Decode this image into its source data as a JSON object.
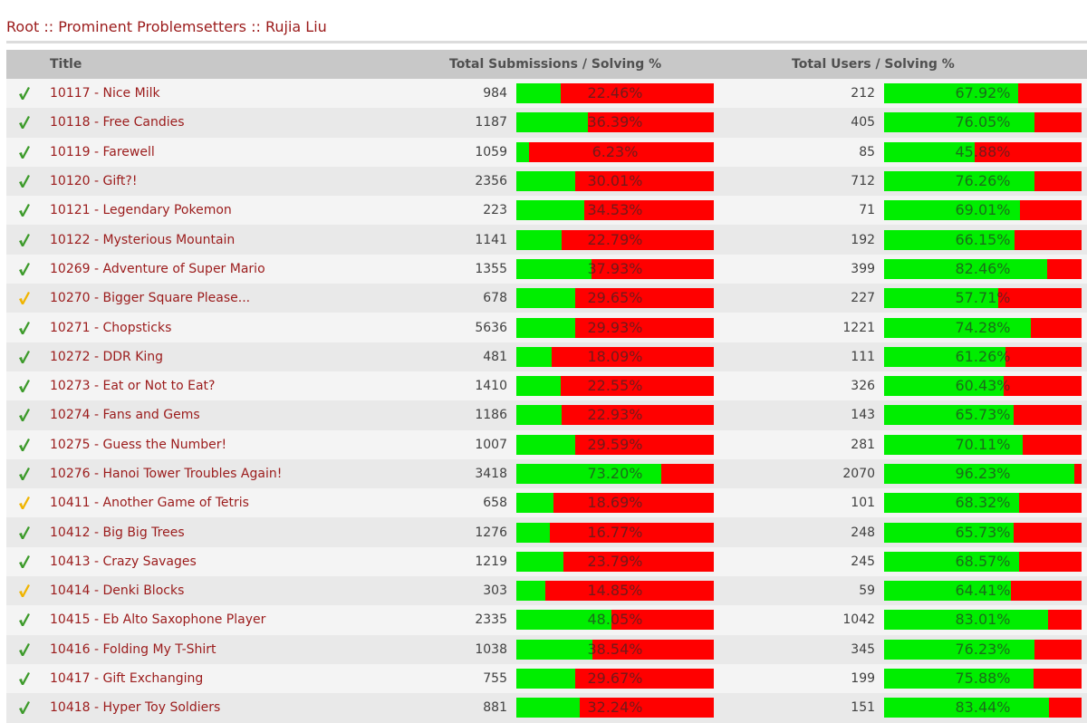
{
  "breadcrumb": [
    "Root",
    "Prominent Problemsetters",
    "Rujia Liu"
  ],
  "breadcrumb_separator": " :: ",
  "colors": {
    "solved": "#3c9a2a",
    "attempted": "#f0b400",
    "bar_solved": "#00ee00",
    "bar_unsolved": "#ff0000",
    "link": "#9b1b1b"
  },
  "table": {
    "headers": {
      "title": "Title",
      "submissions": "Total Submissions / Solving %",
      "users": "Total Users / Solving %"
    },
    "rows": [
      {
        "status": "solved",
        "title": "10117 - Nice Milk",
        "submissions": "984",
        "sub_pct": "22.46%",
        "sub_frac": 0.2246,
        "users": "212",
        "usr_pct": "67.92%",
        "usr_frac": 0.6792
      },
      {
        "status": "solved",
        "title": "10118 - Free Candies",
        "submissions": "1187",
        "sub_pct": "36.39%",
        "sub_frac": 0.3639,
        "users": "405",
        "usr_pct": "76.05%",
        "usr_frac": 0.7605
      },
      {
        "status": "solved",
        "title": "10119 - Farewell",
        "submissions": "1059",
        "sub_pct": "6.23%",
        "sub_frac": 0.0623,
        "users": "85",
        "usr_pct": "45.88%",
        "usr_frac": 0.4588
      },
      {
        "status": "solved",
        "title": "10120 - Gift?!",
        "submissions": "2356",
        "sub_pct": "30.01%",
        "sub_frac": 0.3001,
        "users": "712",
        "usr_pct": "76.26%",
        "usr_frac": 0.7626
      },
      {
        "status": "solved",
        "title": "10121 - Legendary Pokemon",
        "submissions": "223",
        "sub_pct": "34.53%",
        "sub_frac": 0.3453,
        "users": "71",
        "usr_pct": "69.01%",
        "usr_frac": 0.6901
      },
      {
        "status": "solved",
        "title": "10122 - Mysterious Mountain",
        "submissions": "1141",
        "sub_pct": "22.79%",
        "sub_frac": 0.2279,
        "users": "192",
        "usr_pct": "66.15%",
        "usr_frac": 0.6615
      },
      {
        "status": "solved",
        "title": "10269 - Adventure of Super Mario",
        "submissions": "1355",
        "sub_pct": "37.93%",
        "sub_frac": 0.3793,
        "users": "399",
        "usr_pct": "82.46%",
        "usr_frac": 0.8246
      },
      {
        "status": "attempted",
        "title": "10270 - Bigger Square Please...",
        "submissions": "678",
        "sub_pct": "29.65%",
        "sub_frac": 0.2965,
        "users": "227",
        "usr_pct": "57.71%",
        "usr_frac": 0.5771
      },
      {
        "status": "solved",
        "title": "10271 - Chopsticks",
        "submissions": "5636",
        "sub_pct": "29.93%",
        "sub_frac": 0.2993,
        "users": "1221",
        "usr_pct": "74.28%",
        "usr_frac": 0.7428
      },
      {
        "status": "solved",
        "title": "10272 - DDR King",
        "submissions": "481",
        "sub_pct": "18.09%",
        "sub_frac": 0.1809,
        "users": "111",
        "usr_pct": "61.26%",
        "usr_frac": 0.6126
      },
      {
        "status": "solved",
        "title": "10273 - Eat or Not to Eat?",
        "submissions": "1410",
        "sub_pct": "22.55%",
        "sub_frac": 0.2255,
        "users": "326",
        "usr_pct": "60.43%",
        "usr_frac": 0.6043
      },
      {
        "status": "solved",
        "title": "10274 - Fans and Gems",
        "submissions": "1186",
        "sub_pct": "22.93%",
        "sub_frac": 0.2293,
        "users": "143",
        "usr_pct": "65.73%",
        "usr_frac": 0.6573
      },
      {
        "status": "solved",
        "title": "10275 - Guess the Number!",
        "submissions": "1007",
        "sub_pct": "29.59%",
        "sub_frac": 0.2959,
        "users": "281",
        "usr_pct": "70.11%",
        "usr_frac": 0.7011
      },
      {
        "status": "solved",
        "title": "10276 - Hanoi Tower Troubles Again!",
        "submissions": "3418",
        "sub_pct": "73.20%",
        "sub_frac": 0.732,
        "users": "2070",
        "usr_pct": "96.23%",
        "usr_frac": 0.9623
      },
      {
        "status": "attempted",
        "title": "10411 - Another Game of Tetris",
        "submissions": "658",
        "sub_pct": "18.69%",
        "sub_frac": 0.1869,
        "users": "101",
        "usr_pct": "68.32%",
        "usr_frac": 0.6832
      },
      {
        "status": "solved",
        "title": "10412 - Big Big Trees",
        "submissions": "1276",
        "sub_pct": "16.77%",
        "sub_frac": 0.1677,
        "users": "248",
        "usr_pct": "65.73%",
        "usr_frac": 0.6573
      },
      {
        "status": "solved",
        "title": "10413 - Crazy Savages",
        "submissions": "1219",
        "sub_pct": "23.79%",
        "sub_frac": 0.2379,
        "users": "245",
        "usr_pct": "68.57%",
        "usr_frac": 0.6857
      },
      {
        "status": "attempted",
        "title": "10414 - Denki Blocks",
        "submissions": "303",
        "sub_pct": "14.85%",
        "sub_frac": 0.1485,
        "users": "59",
        "usr_pct": "64.41%",
        "usr_frac": 0.6441
      },
      {
        "status": "solved",
        "title": "10415 - Eb Alto Saxophone Player",
        "submissions": "2335",
        "sub_pct": "48.05%",
        "sub_frac": 0.4805,
        "users": "1042",
        "usr_pct": "83.01%",
        "usr_frac": 0.8301
      },
      {
        "status": "solved",
        "title": "10416 - Folding My T-Shirt",
        "submissions": "1038",
        "sub_pct": "38.54%",
        "sub_frac": 0.3854,
        "users": "345",
        "usr_pct": "76.23%",
        "usr_frac": 0.7623
      },
      {
        "status": "solved",
        "title": "10417 - Gift Exchanging",
        "submissions": "755",
        "sub_pct": "29.67%",
        "sub_frac": 0.2967,
        "users": "199",
        "usr_pct": "75.88%",
        "usr_frac": 0.7588
      },
      {
        "status": "solved",
        "title": "10418 - Hyper Toy Soldiers",
        "submissions": "881",
        "sub_pct": "32.24%",
        "sub_frac": 0.3224,
        "users": "151",
        "usr_pct": "83.44%",
        "usr_frac": 0.8344
      }
    ]
  }
}
